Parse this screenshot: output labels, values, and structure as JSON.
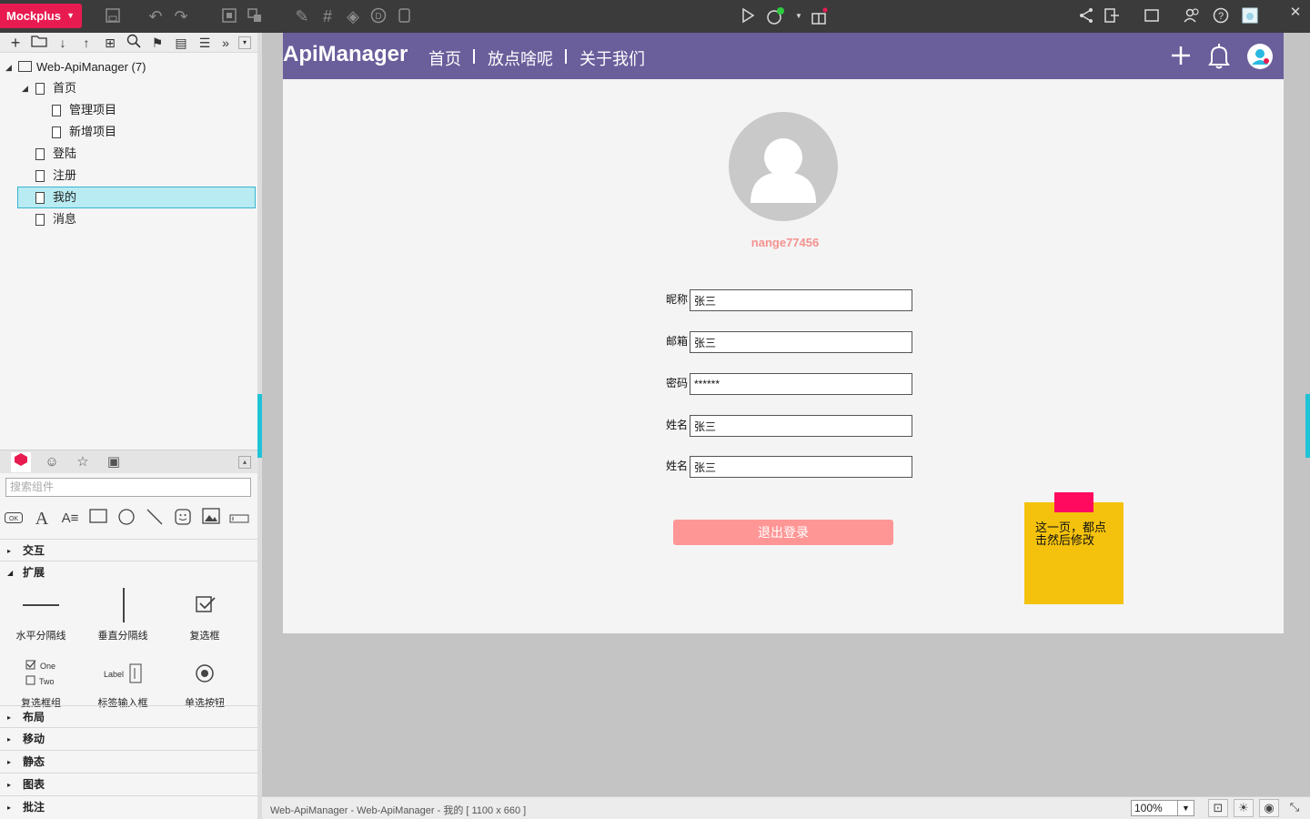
{
  "app": {
    "brand": "Mockplus",
    "brand_color": "#e81b50"
  },
  "toolbar": {
    "icons": [
      "save-icon",
      "undo-icon",
      "redo-icon",
      "group-icon",
      "ungroup-icon",
      "format-brush-icon",
      "grid-icon",
      "paint-bucket-icon",
      "d-icon",
      "copy-page-icon",
      "play-icon",
      "sync-icon",
      "gift-icon",
      "share-icon",
      "export-icon",
      "window-icon",
      "team-icon",
      "help-icon",
      "thumbnail-icon",
      "close-icon"
    ]
  },
  "tree": {
    "root": "Web-ApiManager (7)",
    "items": [
      {
        "label": "首页"
      },
      {
        "label": "管理项目"
      },
      {
        "label": "新增项目"
      },
      {
        "label": "登陆"
      },
      {
        "label": "注册"
      },
      {
        "label": "我的"
      },
      {
        "label": "消息"
      }
    ]
  },
  "components": {
    "search_placeholder": "搜索组件",
    "sections": {
      "interaction": "交互",
      "extension": "扩展",
      "layout": "布局",
      "mobile": "移动",
      "static": "静态",
      "chart": "图表",
      "annotation": "批注"
    },
    "widgets": {
      "hdivider": "水平分隔线",
      "vdivider": "垂直分隔线",
      "checkbox": "复选框",
      "checkbox_group": "复选框组",
      "label_input": "标签输入框",
      "radio": "单选按钮",
      "cb_one": "One",
      "cb_two": "Two",
      "label_text": "Label",
      "ok_text": "OK"
    }
  },
  "page": {
    "brand": "ApiManager",
    "nav": [
      "首页",
      "放点啥呢",
      "关于我们"
    ],
    "nav_color": "#6a5e9b",
    "username": "nange77456",
    "fields": [
      {
        "label": "昵称",
        "value": "张三"
      },
      {
        "label": "邮箱",
        "value": "张三"
      },
      {
        "label": "密码",
        "value": "******"
      },
      {
        "label": "姓名",
        "value": "张三"
      },
      {
        "label": "姓名",
        "value": "张三"
      }
    ],
    "logout": "退出登录",
    "sticky_note": "这一页，都点击然后修改"
  },
  "status": {
    "text": "Web-ApiManager - Web-ApiManager - 我的 [ 1100 x 660 ]",
    "zoom": "100%"
  }
}
